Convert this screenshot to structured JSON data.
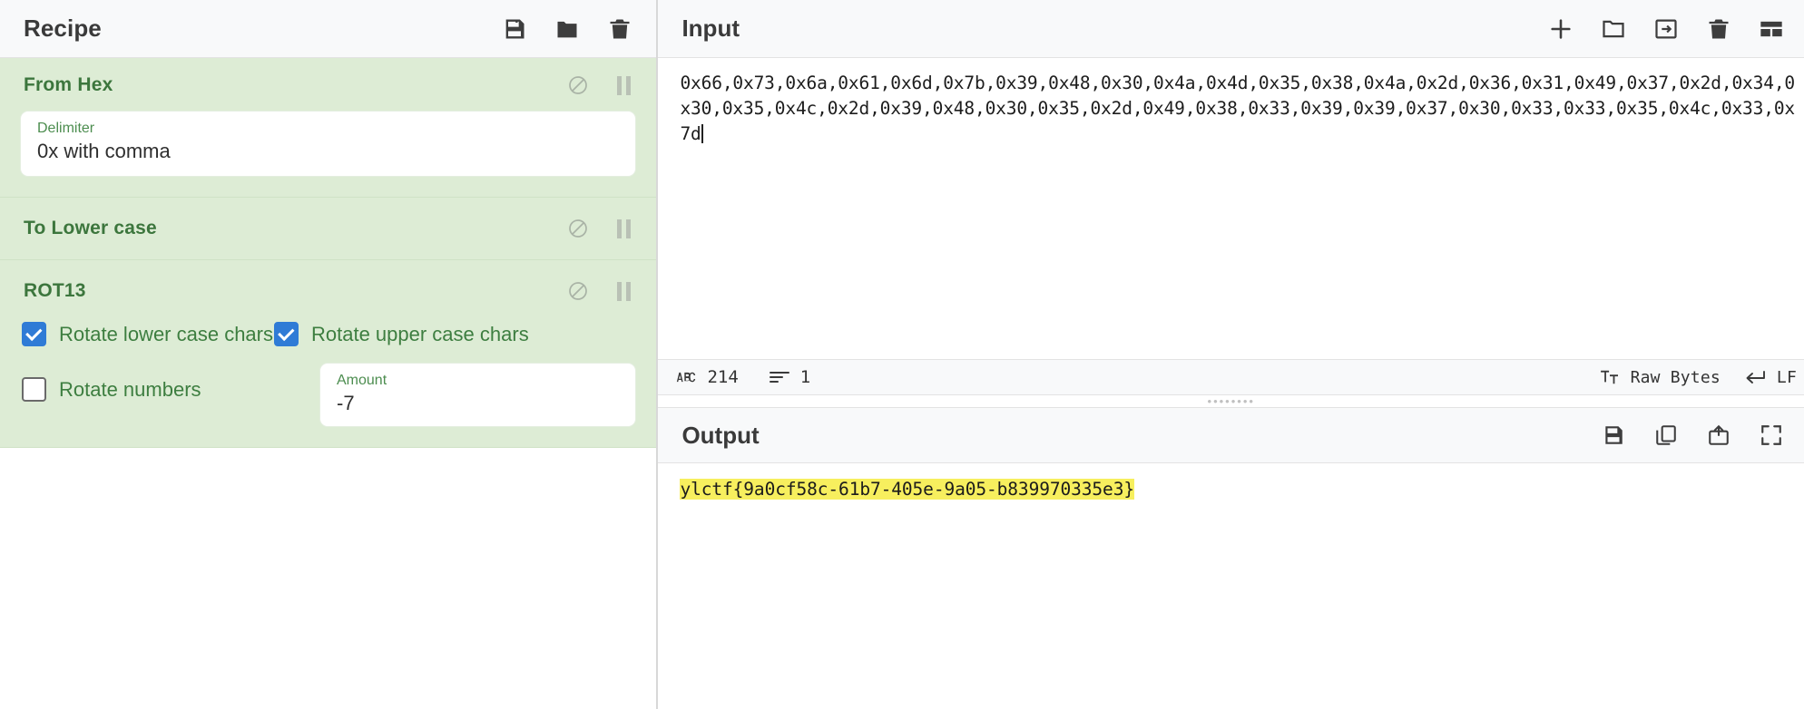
{
  "recipe": {
    "title": "Recipe",
    "header_icons": [
      {
        "name": "save-icon",
        "label": "Save recipe"
      },
      {
        "name": "folder-icon",
        "label": "Load recipe"
      },
      {
        "name": "trash-icon",
        "label": "Clear recipe"
      }
    ],
    "operations": [
      {
        "name": "From Hex",
        "disable_label": "Disable operation",
        "pause_label": "Set breakpoint",
        "args": [
          {
            "type": "text",
            "label": "Delimiter",
            "value": "0x with comma"
          }
        ]
      },
      {
        "name": "To Lower case",
        "disable_label": "Disable operation",
        "pause_label": "Set breakpoint",
        "args": []
      },
      {
        "name": "ROT13",
        "disable_label": "Disable operation",
        "pause_label": "Set breakpoint",
        "args": [
          {
            "type": "checkbox",
            "label": "Rotate lower case chars",
            "checked": true
          },
          {
            "type": "checkbox",
            "label": "Rotate upper case chars",
            "checked": true
          },
          {
            "type": "checkbox",
            "label": "Rotate numbers",
            "checked": false
          },
          {
            "type": "number",
            "label": "Amount",
            "value": "-7"
          }
        ]
      }
    ]
  },
  "input": {
    "title": "Input",
    "header_icons": [
      {
        "name": "add-tab-icon",
        "label": "Add a new input tab"
      },
      {
        "name": "folder-open-icon",
        "label": "Open folder as input"
      },
      {
        "name": "open-file-icon",
        "label": "Open file as input"
      },
      {
        "name": "trash-icon",
        "label": "Clear input and output"
      },
      {
        "name": "reset-pane-layout-icon",
        "label": "Reset pane layout"
      }
    ],
    "lines": [
      "0x66,0x73,0x6a,0x61,0x6d,0x7b,0x39,0x48,0x30,0x4a,0x4d,0x35,0x38,0x4a,0x2d,0x36,0x31,0x49,0x37,0x2d,0x34,0",
      "x30,0x35,0x4c,0x2d,0x39,0x48,0x30,0x35,0x2d,0x49,0x38,0x33,0x39,0x39,0x37,0x30,0x33,0x33,0x35,0x4c,0x33,0x",
      "7d"
    ],
    "status": {
      "length_icon": "abc-icon",
      "length": "214",
      "lines_icon": "lines-icon",
      "lines": "1",
      "format_icon": "text-format-icon",
      "format": "Raw Bytes",
      "eol_icon": "enter-arrow-icon",
      "eol": "LF"
    }
  },
  "output": {
    "title": "Output",
    "header_icons": [
      {
        "name": "save-icon",
        "label": "Save output to file"
      },
      {
        "name": "copy-icon",
        "label": "Copy raw output to clipboard"
      },
      {
        "name": "move-output-to-input-icon",
        "label": "Replace input with output"
      },
      {
        "name": "maximise-icon",
        "label": "Maximise output pane"
      }
    ],
    "text": "ylctf{9a0cf58c-61b7-405e-9a05-b839970335e3}",
    "highlight_color": "#f7ef5e"
  },
  "colors": {
    "op_background": "#ddecd5",
    "op_title": "#3c763d",
    "checkbox_on": "#2f7bd6",
    "header_background": "#f8f9fa"
  }
}
